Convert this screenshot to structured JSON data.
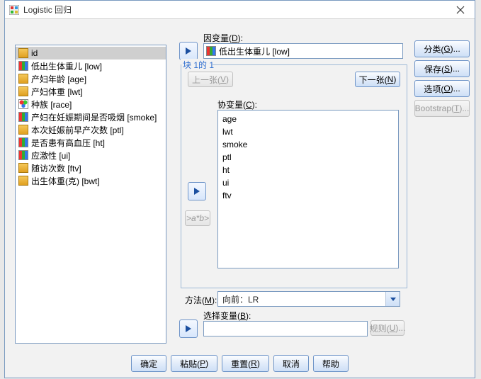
{
  "window": {
    "title": "Logistic 回归"
  },
  "labels": {
    "dependent": "因变量(",
    "dependent_key": "D",
    "block_legend": "块 1的 1",
    "prev": "上一张(",
    "prev_key": "V",
    "next": "下一张(",
    "next_key": "N",
    "covariate": "协变量(",
    "covariate_key": "C",
    "interaction": ">a*b>",
    "method": "方法(",
    "method_key": "M",
    "method_value": "向前：LR",
    "select_var": "选择变量(",
    "select_var_key": "B",
    "rule": "规则(",
    "rule_key": "U"
  },
  "dependent_value": "低出生体重儿 [low]",
  "source_vars": [
    {
      "icon": "ruler",
      "label": "id"
    },
    {
      "icon": "bars",
      "label": "低出生体重儿 [low]"
    },
    {
      "icon": "ruler",
      "label": "产妇年龄 [age]"
    },
    {
      "icon": "ruler",
      "label": "产妇体重 [lwt]"
    },
    {
      "icon": "circles",
      "label": "种族 [race]"
    },
    {
      "icon": "bars",
      "label": "产妇在妊娠期间是否吸烟 [smoke]"
    },
    {
      "icon": "ruler",
      "label": "本次妊娠前早产次数 [ptl]"
    },
    {
      "icon": "bars",
      "label": "是否患有高血压 [ht]"
    },
    {
      "icon": "bars",
      "label": "应激性 [ui]"
    },
    {
      "icon": "ruler",
      "label": "随访次数 [ftv]"
    },
    {
      "icon": "ruler",
      "label": "出生体重(克) [bwt]"
    }
  ],
  "covariates": [
    "age",
    "lwt",
    "smoke",
    "ptl",
    "ht",
    "ui",
    "ftv"
  ],
  "right_buttons": {
    "categorical": "分类(",
    "categorical_key": "G",
    "save": "保存(",
    "save_key": "S",
    "options": "选项(",
    "options_key": "O",
    "bootstrap": "Bootstrap(",
    "bootstrap_key": "T"
  },
  "bottom_buttons": {
    "ok": "确定",
    "paste": "粘贴(",
    "paste_key": "P",
    "reset": "重置(",
    "reset_key": "R",
    "cancel": "取消",
    "help": "帮助"
  }
}
